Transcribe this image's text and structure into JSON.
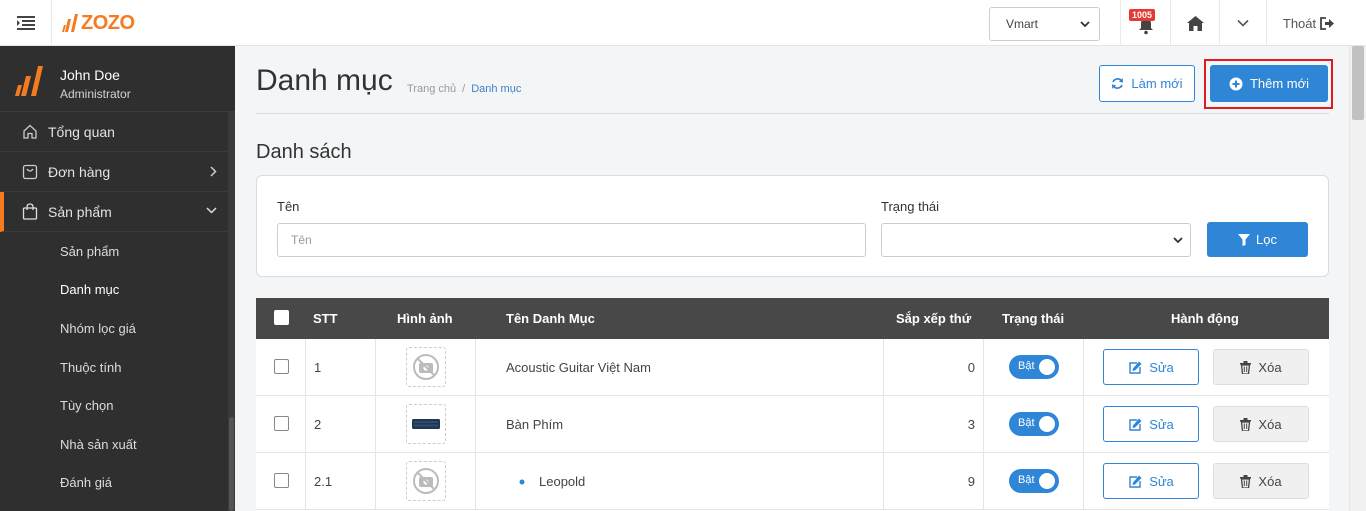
{
  "brand": {
    "logo_text": "ZOZO",
    "accent": "#f47b20",
    "primary": "#2f86d6"
  },
  "topbar": {
    "shop_select": "Vmart",
    "notifications_count": "1005",
    "logout_label": "Thoát"
  },
  "user": {
    "name": "John Doe",
    "role": "Administrator"
  },
  "sidebar": {
    "items": [
      {
        "label": "Tổng quan",
        "icon": "home-outline-icon"
      },
      {
        "label": "Đơn hàng",
        "icon": "order-icon"
      },
      {
        "label": "Sản phẩm",
        "icon": "bag-icon"
      }
    ],
    "sub_items": [
      "Sản phẩm",
      "Danh mục",
      "Nhóm lọc giá",
      "Thuộc tính",
      "Tùy chọn",
      "Nhà sản xuất",
      "Đánh giá"
    ]
  },
  "page": {
    "title": "Danh mục",
    "breadcrumb_home": "Trang chủ",
    "breadcrumb_sep": "/",
    "breadcrumb_current": "Danh mục",
    "refresh_label": "Làm mới",
    "add_label": "Thêm mới",
    "section_title": "Danh sách"
  },
  "filter": {
    "name_label": "Tên",
    "name_placeholder": "Tên",
    "status_label": "Trạng thái",
    "status_value": "",
    "button_label": "Lọc"
  },
  "table": {
    "headers": {
      "stt": "STT",
      "image": "Hình ảnh",
      "name": "Tên Danh Mục",
      "sort_order": "Sắp xếp thứ",
      "status": "Trạng thái",
      "actions": "Hành động"
    },
    "rows": [
      {
        "stt": "1",
        "image": "no-image-icon",
        "name": "Acoustic Guitar Việt Nam",
        "sort": "0",
        "status": "Bật",
        "edit": "Sửa",
        "delete": "Xóa"
      },
      {
        "stt": "2",
        "image": "keyboard-thumbnail",
        "name": "Bàn Phím",
        "sort": "3",
        "status": "Bật",
        "edit": "Sửa",
        "delete": "Xóa"
      },
      {
        "stt": "2.1",
        "image": "no-image-icon",
        "name": "Leopold",
        "sort": "9",
        "status": "Bật",
        "edit": "Sửa",
        "delete": "Xóa"
      }
    ]
  }
}
